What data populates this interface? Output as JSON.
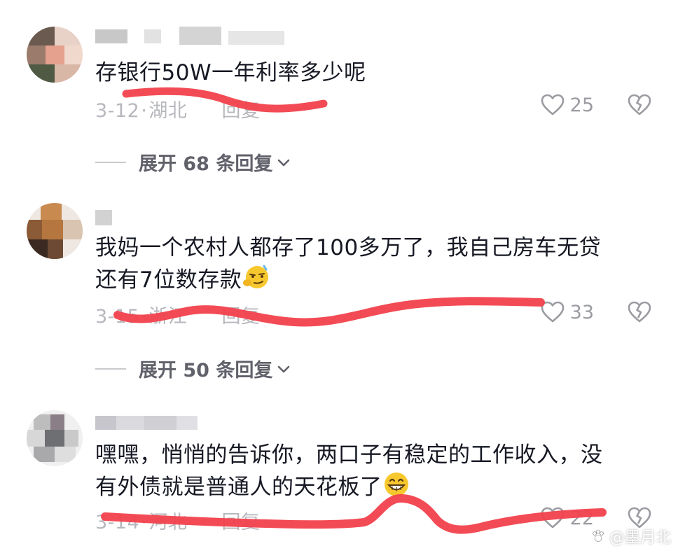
{
  "comments": [
    {
      "text": "存银行50W一年利率多少呢",
      "date": "3-12",
      "location": "湖北",
      "reply_label": "回复",
      "likes": "25",
      "expand_label": "展开 68 条回复"
    },
    {
      "text": "我妈一个农村人都存了100多万了，我自己房车无贷\n还有7位数存款",
      "date": "3-15",
      "location": "浙江",
      "reply_label": "回复",
      "likes": "33",
      "expand_label": "展开 50 条回复"
    },
    {
      "text": "嘿嘿，悄悄的告诉你，两口子有稳定的工作收入，没\n有外债就是普通人的天花板了",
      "date": "3-14",
      "location": "河北",
      "reply_label": "回复",
      "likes": "22"
    }
  ],
  "icons": {
    "like": "heart-outline-icon",
    "dislike": "broken-heart-icon",
    "expand": "chevron-down-icon",
    "emoji_1": "smirking-face-emoji",
    "emoji_2": "grinning-face-emoji"
  },
  "colors": {
    "text": "#161823",
    "meta": "#b7b8bd",
    "scribble": "#f2414c"
  },
  "watermark": "@墨月北"
}
